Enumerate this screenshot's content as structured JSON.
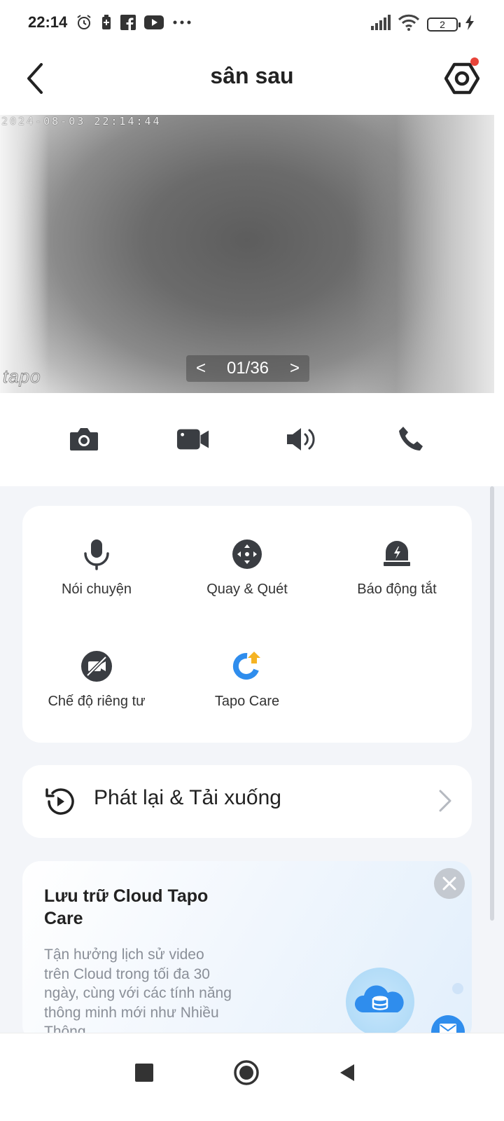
{
  "status_bar": {
    "time": "22:14",
    "battery_level": "2",
    "left_icons": [
      "alarm-icon",
      "battery-saver-icon",
      "facebook-icon",
      "youtube-icon",
      "more-dots-icon"
    ],
    "right_icons": [
      "signal-icon",
      "wifi-icon",
      "battery-icon",
      "charging-icon"
    ]
  },
  "header": {
    "title": "sân sau",
    "has_notification": true
  },
  "video": {
    "timestamp": "2024-08-03 22:14:44",
    "watermark": "tapo",
    "pager": {
      "prev": "<",
      "current": "01/36",
      "next": ">"
    }
  },
  "controls": [
    "snapshot-icon",
    "record-icon",
    "speaker-icon",
    "call-icon"
  ],
  "features": [
    {
      "label": "Nói chuyện",
      "icon": "microphone-icon"
    },
    {
      "label": "Quay & Quét",
      "icon": "pan-tilt-icon"
    },
    {
      "label": "Báo động tắt",
      "icon": "alarm-siren-icon"
    },
    {
      "label": "Chế độ riêng tư",
      "icon": "privacy-icon"
    },
    {
      "label": "Tapo Care",
      "icon": "tapo-care-icon"
    }
  ],
  "playback": {
    "label": "Phát lại & Tải xuống"
  },
  "promo": {
    "title": "Lưu trữ Cloud Tapo Care",
    "description": "Tận hưởng lịch sử video trên Cloud trong tối đa 30 ngày, cùng với các tính năng thông minh mới như Nhiều Thông"
  },
  "colors": {
    "accent": "#2f8ded",
    "notification": "#e8443a",
    "icon_dark": "#3a3d42",
    "tapo_care_orange": "#f5b323",
    "page_gray": "#f3f5f9"
  }
}
